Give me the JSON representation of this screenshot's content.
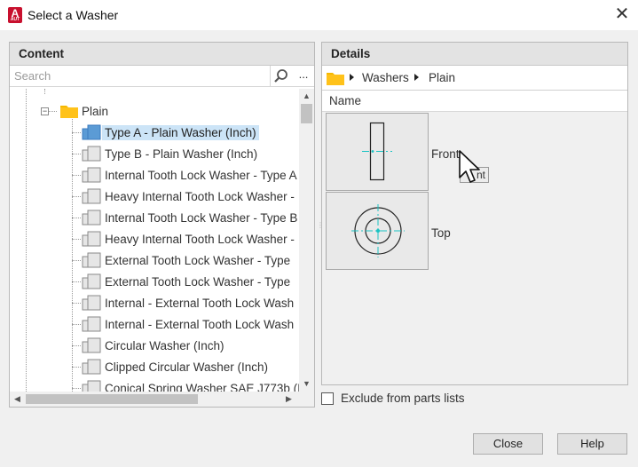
{
  "window": {
    "title": "Select a Washer",
    "app_icon_letter": "A",
    "close_glyph": "✕"
  },
  "content_panel": {
    "header": "Content",
    "search": {
      "placeholder": "Search",
      "more_label": "..."
    },
    "tree": {
      "parent": {
        "label": "Plain",
        "expanded": true
      },
      "items": [
        {
          "label": "Type A - Plain Washer (Inch)",
          "selected": true
        },
        {
          "label": "Type B - Plain Washer (Inch)"
        },
        {
          "label": "Internal Tooth Lock Washer - Type A"
        },
        {
          "label": "Heavy Internal Tooth Lock Washer -"
        },
        {
          "label": "Internal Tooth Lock Washer - Type B"
        },
        {
          "label": "Heavy Internal Tooth Lock Washer -"
        },
        {
          "label": "External Tooth Lock Washer - Type"
        },
        {
          "label": "External Tooth Lock Washer - Type"
        },
        {
          "label": "Internal - External Tooth Lock Wash"
        },
        {
          "label": "Internal - External Tooth Lock Wash"
        },
        {
          "label": "Circular Washer (Inch)"
        },
        {
          "label": "Clipped Circular Washer (Inch)"
        },
        {
          "label": "Conical Spring Washer SAE J773b (I"
        }
      ]
    }
  },
  "details_panel": {
    "header": "Details",
    "breadcrumb": [
      "Washers",
      "Plain"
    ],
    "column_header": "Name",
    "views": [
      {
        "label": "Front",
        "icon": "washer-front-view"
      },
      {
        "label": "Top",
        "icon": "washer-top-view"
      }
    ],
    "tooltip_fragment": "nt"
  },
  "exclude_checkbox": {
    "label": "Exclude from parts lists",
    "checked": false
  },
  "buttons": {
    "close": "Close",
    "help": "Help"
  },
  "colors": {
    "folder": "#f5b800",
    "selected_row": "#cce4f7",
    "app_icon": "#c8102e",
    "centerline": "#19c3c3"
  }
}
